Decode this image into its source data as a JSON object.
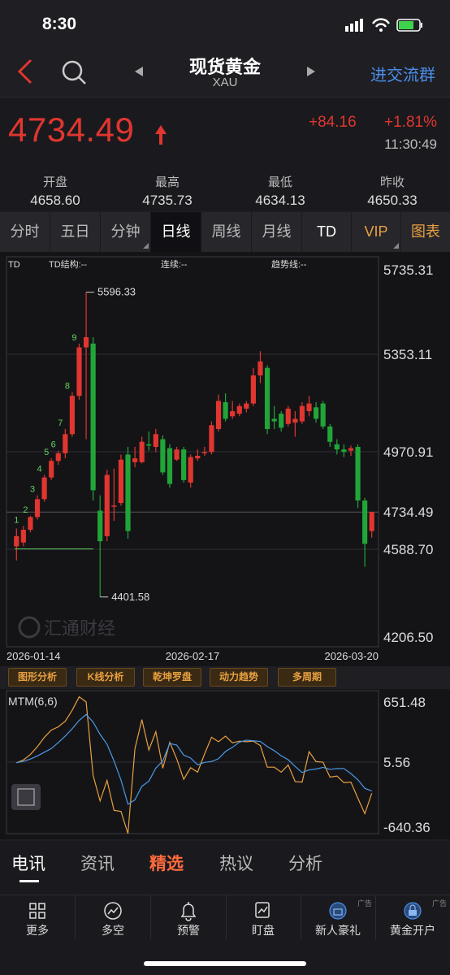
{
  "status": {
    "time": "8:30"
  },
  "nav": {
    "title": "现货黄金",
    "subtitle": "XAU",
    "right_link": "进交流群"
  },
  "quote": {
    "price": "4734.49",
    "change": "+84.16",
    "change_pct": "+1.81%",
    "time": "11:30:49"
  },
  "stats": [
    {
      "label": "开盘",
      "value": "4658.60"
    },
    {
      "label": "最高",
      "value": "4735.73"
    },
    {
      "label": "最低",
      "value": "4634.13"
    },
    {
      "label": "昨收",
      "value": "4650.33"
    }
  ],
  "tabs": [
    "分时",
    "五日",
    "分钟",
    "日线",
    "周线",
    "月线",
    "TD",
    "VIP",
    "图表"
  ],
  "chart": {
    "header": {
      "td": "TD",
      "td_struct": "TD结构:--",
      "continuous": "连续:--",
      "trendline": "趋势线:--"
    },
    "y_ticks": [
      "5735.31",
      "5353.11",
      "4970.91",
      "4734.49",
      "4588.70",
      "4206.50"
    ],
    "x_labels": [
      "2026-01-14",
      "2026-02-17",
      "2026-03-20"
    ],
    "high_label": "5596.33",
    "low_label": "4401.58",
    "watermark": "汇通财经",
    "td_counts": [
      "1",
      "2",
      "3",
      "4",
      "5",
      "6",
      "7",
      "8",
      "9"
    ],
    "colors": {
      "up": "#e0362f",
      "down": "#22a538"
    }
  },
  "chart_data": {
    "type": "candlestick",
    "ylim": [
      4206.5,
      5735.31
    ],
    "candles": [
      {
        "o": 4600,
        "h": 4670,
        "l": 4545,
        "c": 4640
      },
      {
        "o": 4615,
        "h": 4680,
        "l": 4600,
        "c": 4665
      },
      {
        "o": 4665,
        "h": 4720,
        "l": 4655,
        "c": 4715
      },
      {
        "o": 4715,
        "h": 4800,
        "l": 4705,
        "c": 4785
      },
      {
        "o": 4785,
        "h": 4880,
        "l": 4775,
        "c": 4870
      },
      {
        "o": 4870,
        "h": 4945,
        "l": 4860,
        "c": 4935
      },
      {
        "o": 4935,
        "h": 4975,
        "l": 4920,
        "c": 4965
      },
      {
        "o": 4965,
        "h": 5060,
        "l": 4945,
        "c": 5040
      },
      {
        "o": 5040,
        "h": 5205,
        "l": 5030,
        "c": 5190
      },
      {
        "o": 5190,
        "h": 5395,
        "l": 5175,
        "c": 5380
      },
      {
        "o": 5380,
        "h": 5596.33,
        "l": 5020,
        "c": 5420
      },
      {
        "o": 5395,
        "h": 5420,
        "l": 4780,
        "c": 4820
      },
      {
        "o": 4740,
        "h": 4800,
        "l": 4401.58,
        "c": 4620
      },
      {
        "o": 4640,
        "h": 4900,
        "l": 4620,
        "c": 4880
      },
      {
        "o": 4760,
        "h": 4905,
        "l": 4700,
        "c": 4760
      },
      {
        "o": 4770,
        "h": 4960,
        "l": 4760,
        "c": 4940
      },
      {
        "o": 4960,
        "h": 4990,
        "l": 4630,
        "c": 4660
      },
      {
        "o": 4930,
        "h": 4990,
        "l": 4910,
        "c": 4945
      },
      {
        "o": 4930,
        "h": 5030,
        "l": 4925,
        "c": 5010
      },
      {
        "o": 5000,
        "h": 5050,
        "l": 4975,
        "c": 4995
      },
      {
        "o": 4990,
        "h": 5060,
        "l": 4970,
        "c": 5040
      },
      {
        "o": 5020,
        "h": 5035,
        "l": 4880,
        "c": 4890
      },
      {
        "o": 4985,
        "h": 5000,
        "l": 4830,
        "c": 4845
      },
      {
        "o": 4940,
        "h": 4990,
        "l": 4935,
        "c": 4980
      },
      {
        "o": 4980,
        "h": 4990,
        "l": 4850,
        "c": 4860
      },
      {
        "o": 4850,
        "h": 4960,
        "l": 4830,
        "c": 4950
      },
      {
        "o": 4945,
        "h": 4980,
        "l": 4935,
        "c": 4955
      },
      {
        "o": 4965,
        "h": 4990,
        "l": 4955,
        "c": 4970
      },
      {
        "o": 4970,
        "h": 5090,
        "l": 4960,
        "c": 5075
      },
      {
        "o": 5060,
        "h": 5195,
        "l": 5050,
        "c": 5170
      },
      {
        "o": 5165,
        "h": 5200,
        "l": 5090,
        "c": 5100
      },
      {
        "o": 5110,
        "h": 5170,
        "l": 5100,
        "c": 5130
      },
      {
        "o": 5120,
        "h": 5160,
        "l": 5110,
        "c": 5150
      },
      {
        "o": 5140,
        "h": 5170,
        "l": 5125,
        "c": 5160
      },
      {
        "o": 5160,
        "h": 5300,
        "l": 5150,
        "c": 5270
      },
      {
        "o": 5270,
        "h": 5365,
        "l": 5240,
        "c": 5325
      },
      {
        "o": 5300,
        "h": 5310,
        "l": 5040,
        "c": 5060
      },
      {
        "o": 5100,
        "h": 5150,
        "l": 5060,
        "c": 5090
      },
      {
        "o": 5120,
        "h": 5130,
        "l": 5050,
        "c": 5065
      },
      {
        "o": 5080,
        "h": 5150,
        "l": 5070,
        "c": 5140
      },
      {
        "o": 5085,
        "h": 5130,
        "l": 5030,
        "c": 5100
      },
      {
        "o": 5090,
        "h": 5165,
        "l": 5080,
        "c": 5150
      },
      {
        "o": 5130,
        "h": 5190,
        "l": 5110,
        "c": 5160
      },
      {
        "o": 5145,
        "h": 5165,
        "l": 5085,
        "c": 5100
      },
      {
        "o": 5160,
        "h": 5170,
        "l": 5060,
        "c": 5070
      },
      {
        "o": 5070,
        "h": 5080,
        "l": 4990,
        "c": 5010
      },
      {
        "o": 5000,
        "h": 5020,
        "l": 4960,
        "c": 4980
      },
      {
        "o": 4980,
        "h": 5000,
        "l": 4950,
        "c": 4970
      },
      {
        "o": 4975,
        "h": 4995,
        "l": 4955,
        "c": 4985
      },
      {
        "o": 4990,
        "h": 5000,
        "l": 4750,
        "c": 4780
      },
      {
        "o": 4780,
        "h": 4790,
        "l": 4520,
        "c": 4610
      },
      {
        "o": 4660,
        "h": 4735.73,
        "l": 4634.13,
        "c": 4734.49
      }
    ],
    "mtm": {
      "ylim": [
        -640.36,
        651.48
      ],
      "y_ticks": [
        "651.48",
        "5.56",
        "-640.36"
      ],
      "label": "MTM(6,6)"
    }
  },
  "bottom_tabs": [
    "电讯",
    "资讯",
    "精选",
    "热议",
    "分析"
  ],
  "toolbar": [
    {
      "icon": "grid-icon",
      "label": "更多"
    },
    {
      "icon": "bull-bear-icon",
      "label": "多空"
    },
    {
      "icon": "bell-icon",
      "label": "预警"
    },
    {
      "icon": "chart-box-icon",
      "label": "盯盘"
    },
    {
      "icon": "gift-icon",
      "label": "新人豪礼",
      "ad": "广告"
    },
    {
      "icon": "lock-icon",
      "label": "黄金开户",
      "ad": "广告"
    }
  ],
  "chips": [
    "图形分析",
    "K线分析",
    "乾坤罗盘",
    "动力趋势",
    "多周期"
  ]
}
